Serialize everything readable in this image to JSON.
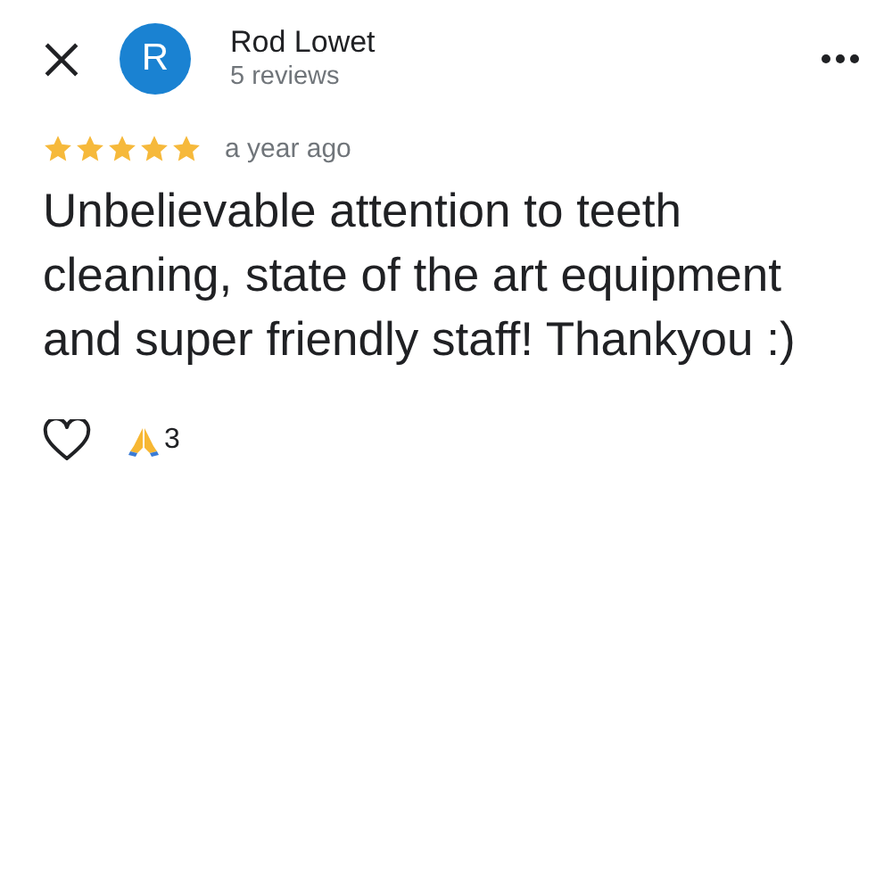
{
  "reviewer": {
    "initial": "R",
    "name": "Rod Lowet",
    "reviews": "5 reviews"
  },
  "review": {
    "stars": 5,
    "time": "a year ago",
    "text": "Unbelievable attention to teeth cleaning, state of the art equipment and super friendly staff! Thankyou :)"
  },
  "reactions": {
    "liked": false,
    "count": "3"
  }
}
